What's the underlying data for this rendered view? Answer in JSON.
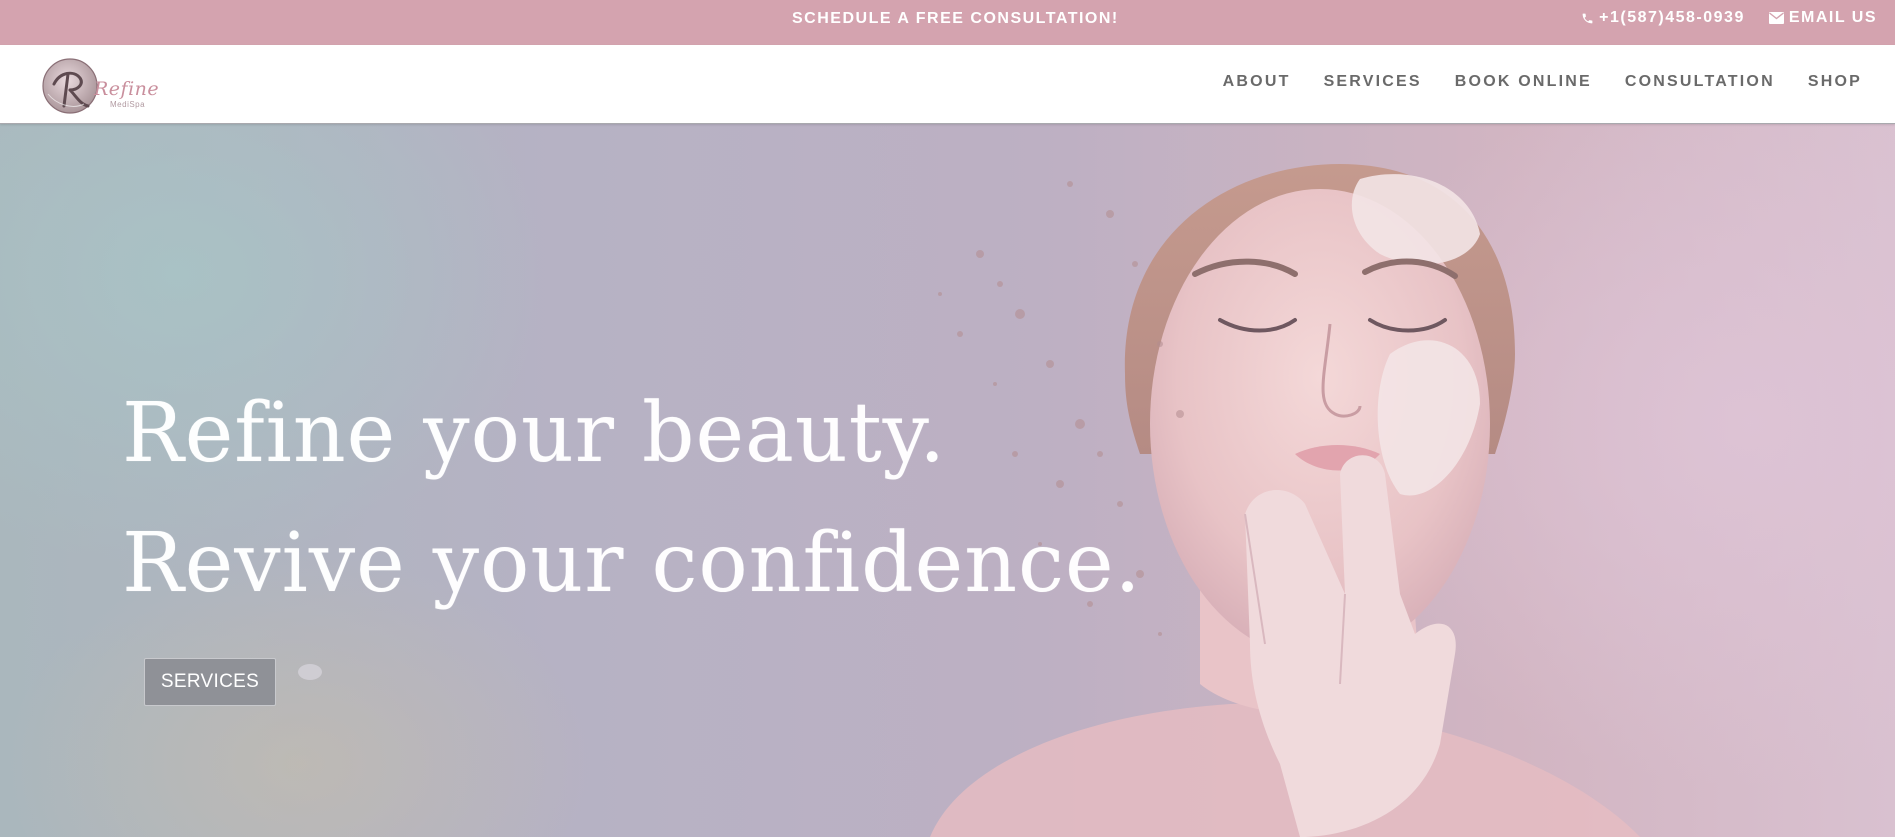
{
  "topbar": {
    "cta_label": "SCHEDULE A FREE CONSULTATION!",
    "phone": "+1(587)458-0939",
    "email_label": "EMAIL US"
  },
  "header": {
    "logo_text": "Refine",
    "logo_sub": "MediSpa",
    "nav": [
      {
        "label": "ABOUT"
      },
      {
        "label": "SERVICES"
      },
      {
        "label": "BOOK ONLINE"
      },
      {
        "label": "CONSULTATION"
      },
      {
        "label": "SHOP"
      }
    ]
  },
  "hero": {
    "headline_line1": "Refine your beauty.",
    "headline_line2": "Revive your confidence.",
    "button_label": "SERVICES"
  },
  "icons": {
    "phone": "phone-icon",
    "email": "envelope-icon"
  },
  "colors": {
    "topbar_bg": "#d4a3af",
    "nav_text": "#6a6a6a",
    "button_bg": "#8f9197"
  }
}
